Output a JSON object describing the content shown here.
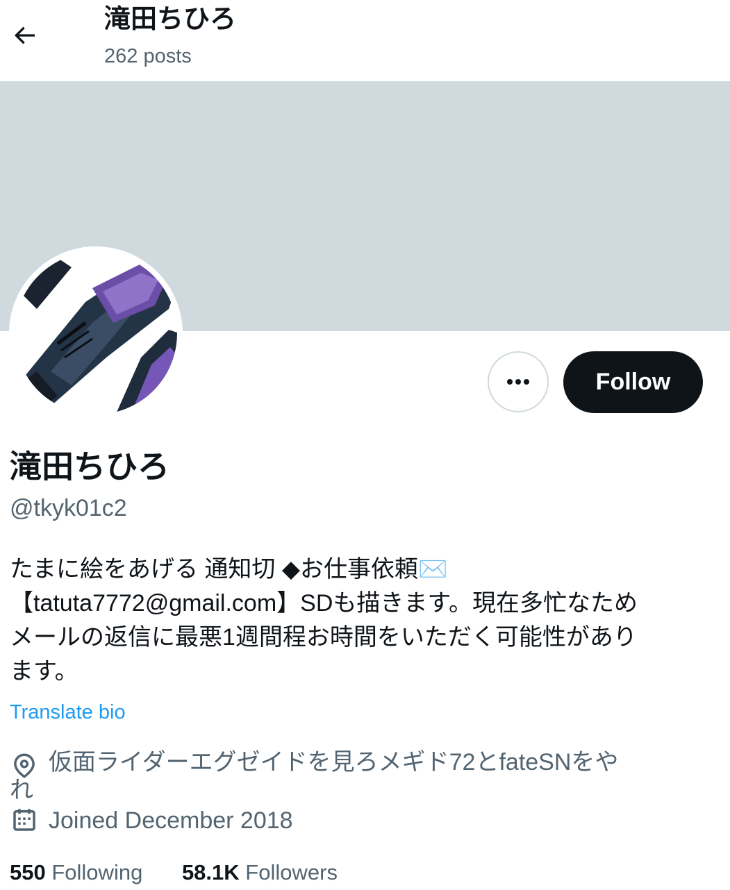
{
  "header": {
    "display_name": "滝田ちひろ",
    "posts_count": "262 posts"
  },
  "profile": {
    "display_name": "滝田ちひろ",
    "handle": "@tkyk01c2",
    "bio": "たまに絵をあげる 通知切 ◆お仕事依頼✉️\n【tatuta7772@gmail.com】SDも描きます。現在多忙なため\nメールの返信に最悪1週間程お時間をいただく可能性があり\nます。",
    "translate_label": "Translate bio",
    "location_line1": "仮面ライダーエグゼイドを見ろメギド72とfateSNをや",
    "location_line2": "れ",
    "joined": "Joined December 2018"
  },
  "actions": {
    "follow_label": "Follow"
  },
  "stats": {
    "following_count": "550",
    "following_label": "Following",
    "followers_count": "58.1K",
    "followers_label": "Followers"
  },
  "colors": {
    "banner": "#cfd9de",
    "text_primary": "#0f1419",
    "text_secondary": "#536471",
    "link": "#1d9bf0",
    "follow_bg": "#0f1419"
  },
  "icons": [
    "back-arrow-icon",
    "more-icon",
    "location-icon",
    "calendar-icon"
  ]
}
